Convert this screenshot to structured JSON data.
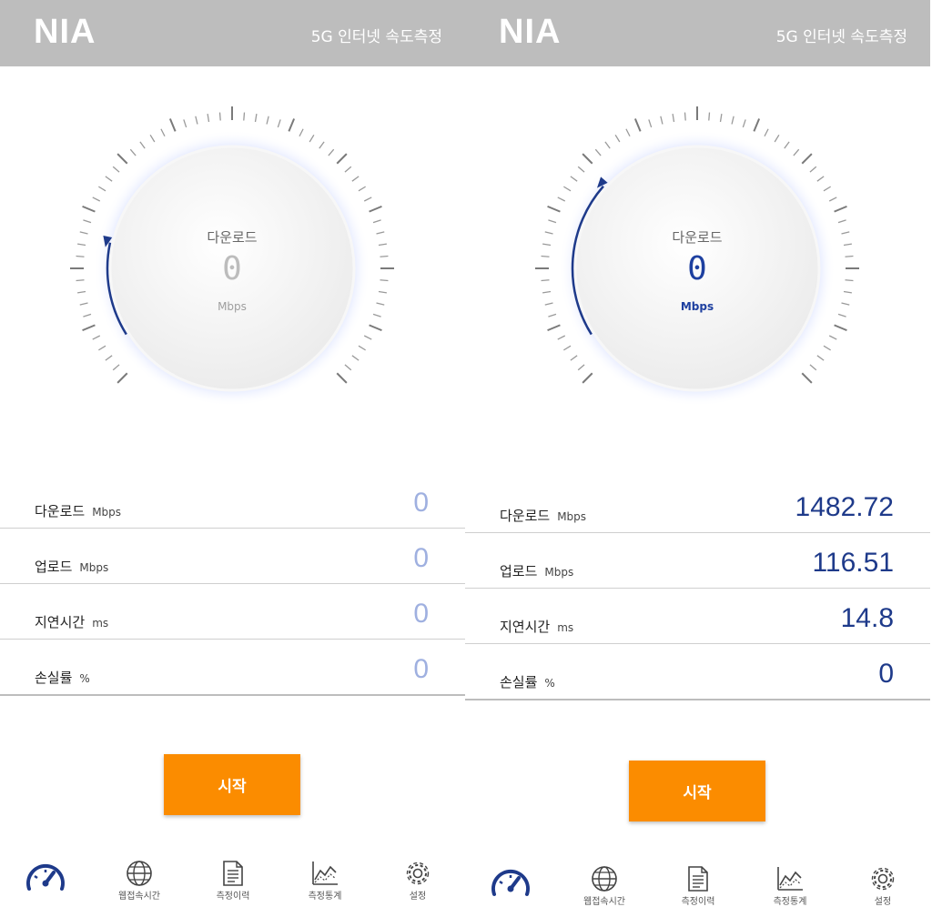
{
  "screens": [
    {
      "id": "left",
      "header": {
        "logo": "NIA",
        "title": "5G 인터넷 속도측정"
      },
      "gauge": {
        "label": "다운로드",
        "value": "0",
        "unit": "Mbps",
        "progress": 0
      },
      "metrics": [
        {
          "label": "다운로드",
          "unit": "Mbps",
          "value": "0"
        },
        {
          "label": "업로드",
          "unit": "Mbps",
          "value": "0"
        },
        {
          "label": "지연시간",
          "unit": "ms",
          "value": "0"
        },
        {
          "label": "손실률",
          "unit": "%",
          "value": "0"
        }
      ],
      "start_button": "시작",
      "tabs": [
        {
          "label": "",
          "icon": "speedometer-icon"
        },
        {
          "label": "웹접속시간",
          "icon": "globe-icon"
        },
        {
          "label": "측정이력",
          "icon": "document-icon"
        },
        {
          "label": "측정통계",
          "icon": "chart-icon"
        },
        {
          "label": "설정",
          "icon": "gear-icon"
        }
      ]
    },
    {
      "id": "right",
      "header": {
        "logo": "NIA",
        "title": "5G 인터넷 속도측정"
      },
      "gauge": {
        "label": "다운로드",
        "value": "0",
        "unit": "Mbps",
        "progress": 0.3
      },
      "metrics": [
        {
          "label": "다운로드",
          "unit": "Mbps",
          "value": "1482.72"
        },
        {
          "label": "업로드",
          "unit": "Mbps",
          "value": "116.51"
        },
        {
          "label": "지연시간",
          "unit": "ms",
          "value": "14.8"
        },
        {
          "label": "손실률",
          "unit": "%",
          "value": "0"
        }
      ],
      "start_button": "시작",
      "tabs": [
        {
          "label": "",
          "icon": "speedometer-icon"
        },
        {
          "label": "웹접속시간",
          "icon": "globe-icon"
        },
        {
          "label": "측정이력",
          "icon": "document-icon"
        },
        {
          "label": "측정통계",
          "icon": "chart-icon"
        },
        {
          "label": "설정",
          "icon": "gear-icon"
        }
      ]
    }
  ],
  "colors": {
    "header_bg": "#bdbdbd",
    "accent_blue": "#1e3a8a",
    "button_orange": "#fb8c00"
  }
}
